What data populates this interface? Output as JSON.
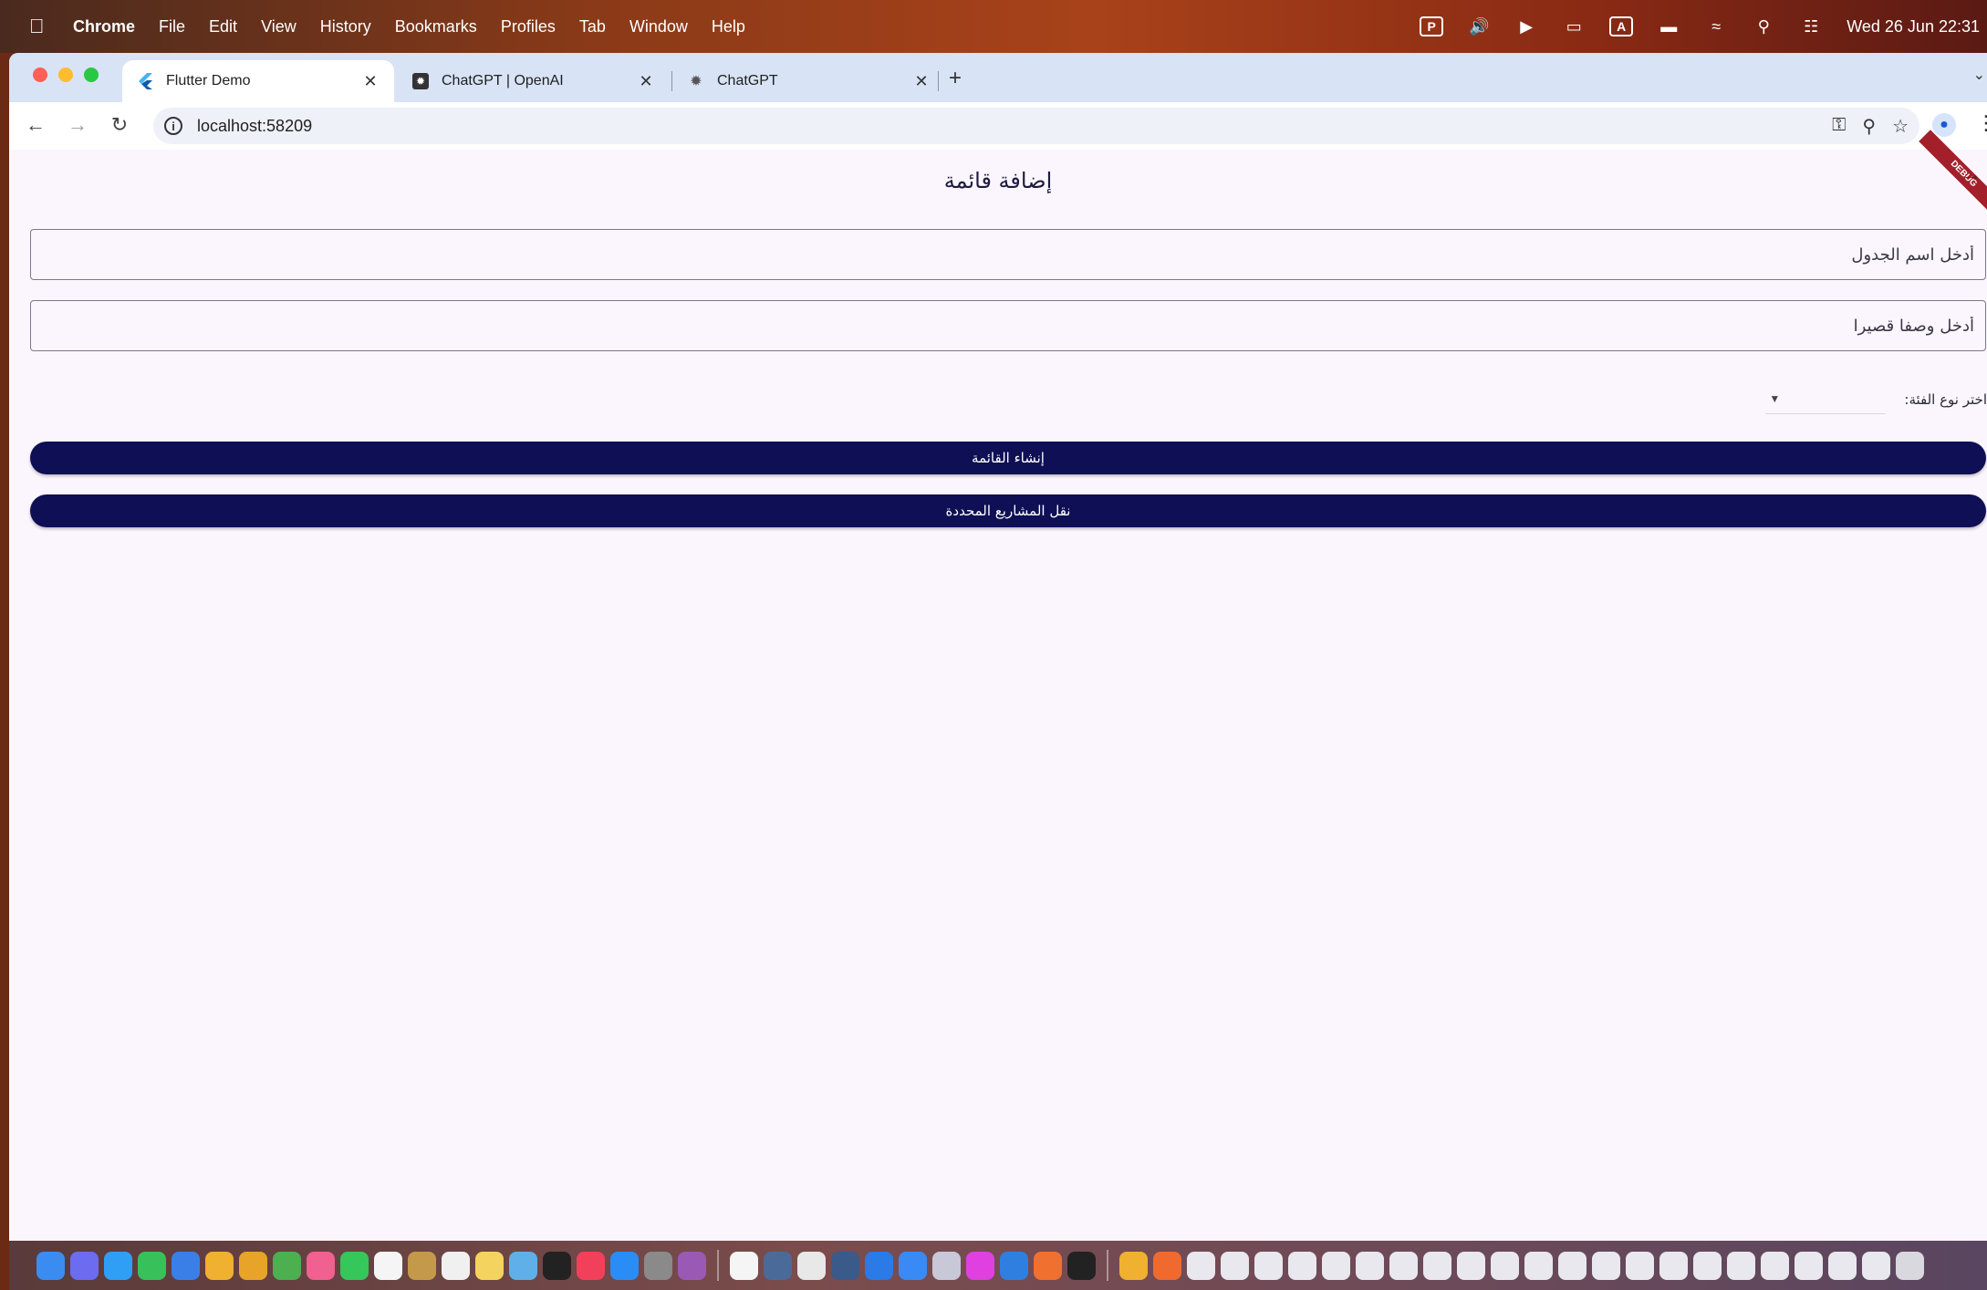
{
  "menubar": {
    "app_name": "Chrome",
    "items": [
      "File",
      "Edit",
      "View",
      "History",
      "Bookmarks",
      "Profiles",
      "Tab",
      "Window",
      "Help"
    ],
    "clock": "Wed 26 Jun  22:31",
    "input_indicator": "A"
  },
  "tabs": [
    {
      "label": "Flutter Demo",
      "active": true
    },
    {
      "label": "ChatGPT | OpenAI",
      "active": false
    },
    {
      "label": "ChatGPT",
      "active": false
    }
  ],
  "address_bar": {
    "url": "localhost:58209"
  },
  "page": {
    "title": "إضافة قائمة",
    "table_name_placeholder": "أدخل اسم الجدول",
    "description_placeholder": "أدخل وصفا قصيرا",
    "category_label": "اختر نوع الفئة:",
    "create_button": "إنشاء القائمة",
    "move_button": "نقل المشاريع المحددة",
    "debug_banner": "DEBUG"
  },
  "colors": {
    "primary_button": "#0f0f55",
    "page_background": "#fbf6fd",
    "tabstrip": "#d8e3f5"
  },
  "dock_icons": [
    "finder",
    "launchpad",
    "safari",
    "messages",
    "mail",
    "chrome",
    "chrome-alt",
    "maps",
    "photos",
    "facetime",
    "calendar",
    "contacts",
    "reminders",
    "notes",
    "freeform",
    "tv",
    "music",
    "app-store",
    "system-settings",
    "podcasts",
    "p-app",
    "preview",
    "script",
    "quicktime",
    "xcode",
    "app-store-2",
    "disk-utility",
    "flower",
    "vscode",
    "sublime",
    "terminal",
    "chrome-3",
    "swift",
    "window-1",
    "window-2",
    "window-3",
    "window-4",
    "window-5",
    "window-6",
    "window-7",
    "window-8",
    "window-9",
    "window-10",
    "window-11",
    "window-12",
    "window-13",
    "window-14",
    "window-15",
    "window-16",
    "window-17",
    "window-18",
    "window-19",
    "window-20",
    "window-21",
    "trash"
  ]
}
